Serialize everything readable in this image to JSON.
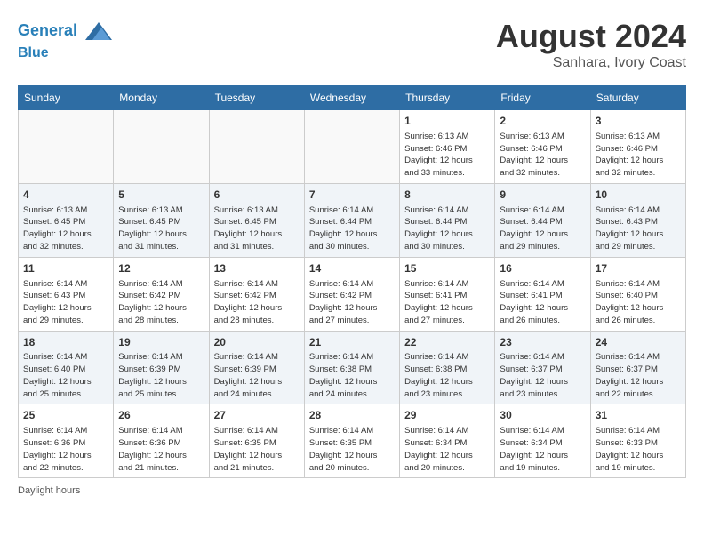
{
  "header": {
    "logo_line1": "General",
    "logo_line2": "Blue",
    "month_year": "August 2024",
    "location": "Sanhara, Ivory Coast"
  },
  "days_of_week": [
    "Sunday",
    "Monday",
    "Tuesday",
    "Wednesday",
    "Thursday",
    "Friday",
    "Saturday"
  ],
  "footer": {
    "note": "Daylight hours"
  },
  "weeks": [
    {
      "days": [
        {
          "num": "",
          "info": ""
        },
        {
          "num": "",
          "info": ""
        },
        {
          "num": "",
          "info": ""
        },
        {
          "num": "",
          "info": ""
        },
        {
          "num": "1",
          "info": "Sunrise: 6:13 AM\nSunset: 6:46 PM\nDaylight: 12 hours\nand 33 minutes."
        },
        {
          "num": "2",
          "info": "Sunrise: 6:13 AM\nSunset: 6:46 PM\nDaylight: 12 hours\nand 32 minutes."
        },
        {
          "num": "3",
          "info": "Sunrise: 6:13 AM\nSunset: 6:46 PM\nDaylight: 12 hours\nand 32 minutes."
        }
      ]
    },
    {
      "days": [
        {
          "num": "4",
          "info": "Sunrise: 6:13 AM\nSunset: 6:45 PM\nDaylight: 12 hours\nand 32 minutes."
        },
        {
          "num": "5",
          "info": "Sunrise: 6:13 AM\nSunset: 6:45 PM\nDaylight: 12 hours\nand 31 minutes."
        },
        {
          "num": "6",
          "info": "Sunrise: 6:13 AM\nSunset: 6:45 PM\nDaylight: 12 hours\nand 31 minutes."
        },
        {
          "num": "7",
          "info": "Sunrise: 6:14 AM\nSunset: 6:44 PM\nDaylight: 12 hours\nand 30 minutes."
        },
        {
          "num": "8",
          "info": "Sunrise: 6:14 AM\nSunset: 6:44 PM\nDaylight: 12 hours\nand 30 minutes."
        },
        {
          "num": "9",
          "info": "Sunrise: 6:14 AM\nSunset: 6:44 PM\nDaylight: 12 hours\nand 29 minutes."
        },
        {
          "num": "10",
          "info": "Sunrise: 6:14 AM\nSunset: 6:43 PM\nDaylight: 12 hours\nand 29 minutes."
        }
      ]
    },
    {
      "days": [
        {
          "num": "11",
          "info": "Sunrise: 6:14 AM\nSunset: 6:43 PM\nDaylight: 12 hours\nand 29 minutes."
        },
        {
          "num": "12",
          "info": "Sunrise: 6:14 AM\nSunset: 6:42 PM\nDaylight: 12 hours\nand 28 minutes."
        },
        {
          "num": "13",
          "info": "Sunrise: 6:14 AM\nSunset: 6:42 PM\nDaylight: 12 hours\nand 28 minutes."
        },
        {
          "num": "14",
          "info": "Sunrise: 6:14 AM\nSunset: 6:42 PM\nDaylight: 12 hours\nand 27 minutes."
        },
        {
          "num": "15",
          "info": "Sunrise: 6:14 AM\nSunset: 6:41 PM\nDaylight: 12 hours\nand 27 minutes."
        },
        {
          "num": "16",
          "info": "Sunrise: 6:14 AM\nSunset: 6:41 PM\nDaylight: 12 hours\nand 26 minutes."
        },
        {
          "num": "17",
          "info": "Sunrise: 6:14 AM\nSunset: 6:40 PM\nDaylight: 12 hours\nand 26 minutes."
        }
      ]
    },
    {
      "days": [
        {
          "num": "18",
          "info": "Sunrise: 6:14 AM\nSunset: 6:40 PM\nDaylight: 12 hours\nand 25 minutes."
        },
        {
          "num": "19",
          "info": "Sunrise: 6:14 AM\nSunset: 6:39 PM\nDaylight: 12 hours\nand 25 minutes."
        },
        {
          "num": "20",
          "info": "Sunrise: 6:14 AM\nSunset: 6:39 PM\nDaylight: 12 hours\nand 24 minutes."
        },
        {
          "num": "21",
          "info": "Sunrise: 6:14 AM\nSunset: 6:38 PM\nDaylight: 12 hours\nand 24 minutes."
        },
        {
          "num": "22",
          "info": "Sunrise: 6:14 AM\nSunset: 6:38 PM\nDaylight: 12 hours\nand 23 minutes."
        },
        {
          "num": "23",
          "info": "Sunrise: 6:14 AM\nSunset: 6:37 PM\nDaylight: 12 hours\nand 23 minutes."
        },
        {
          "num": "24",
          "info": "Sunrise: 6:14 AM\nSunset: 6:37 PM\nDaylight: 12 hours\nand 22 minutes."
        }
      ]
    },
    {
      "days": [
        {
          "num": "25",
          "info": "Sunrise: 6:14 AM\nSunset: 6:36 PM\nDaylight: 12 hours\nand 22 minutes."
        },
        {
          "num": "26",
          "info": "Sunrise: 6:14 AM\nSunset: 6:36 PM\nDaylight: 12 hours\nand 21 minutes."
        },
        {
          "num": "27",
          "info": "Sunrise: 6:14 AM\nSunset: 6:35 PM\nDaylight: 12 hours\nand 21 minutes."
        },
        {
          "num": "28",
          "info": "Sunrise: 6:14 AM\nSunset: 6:35 PM\nDaylight: 12 hours\nand 20 minutes."
        },
        {
          "num": "29",
          "info": "Sunrise: 6:14 AM\nSunset: 6:34 PM\nDaylight: 12 hours\nand 20 minutes."
        },
        {
          "num": "30",
          "info": "Sunrise: 6:14 AM\nSunset: 6:34 PM\nDaylight: 12 hours\nand 19 minutes."
        },
        {
          "num": "31",
          "info": "Sunrise: 6:14 AM\nSunset: 6:33 PM\nDaylight: 12 hours\nand 19 minutes."
        }
      ]
    }
  ]
}
